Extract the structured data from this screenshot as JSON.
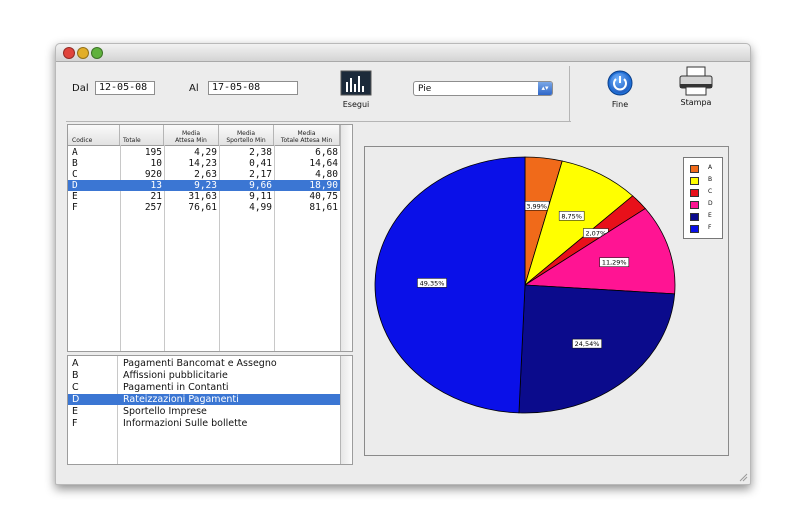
{
  "toolbar": {
    "dal_label": "Dal",
    "dal_value": "12-05-08",
    "al_label": "Al",
    "al_value": "17-05-08",
    "esegui_label": "Esegui",
    "chart_type": "Pie",
    "fine_label": "Fine",
    "stampa_label": "Stampa"
  },
  "table": {
    "headers": [
      "Codice",
      "Totale",
      "Media\nAttesa Min",
      "Media\nSportello Min",
      "Media\nTotale Attesa Min"
    ],
    "rows": [
      {
        "codice": "A",
        "totale": "195",
        "attesa": "4,29",
        "sportello": "2,38",
        "totale_attesa": "6,68"
      },
      {
        "codice": "B",
        "totale": "10",
        "attesa": "14,23",
        "sportello": "0,41",
        "totale_attesa": "14,64"
      },
      {
        "codice": "C",
        "totale": "920",
        "attesa": "2,63",
        "sportello": "2,17",
        "totale_attesa": "4,80"
      },
      {
        "codice": "D",
        "totale": "13",
        "attesa": "9,23",
        "sportello": "9,66",
        "totale_attesa": "18,90"
      },
      {
        "codice": "E",
        "totale": "21",
        "attesa": "31,63",
        "sportello": "9,11",
        "totale_attesa": "40,75"
      },
      {
        "codice": "F",
        "totale": "257",
        "attesa": "76,61",
        "sportello": "4,99",
        "totale_attesa": "81,61"
      }
    ],
    "selected_index": 3
  },
  "list": {
    "items": [
      {
        "code": "A",
        "desc": "Pagamenti Bancomat e Assegno"
      },
      {
        "code": "B",
        "desc": "Affissioni pubblicitarie"
      },
      {
        "code": "C",
        "desc": "Pagamenti  in Contanti"
      },
      {
        "code": "D",
        "desc": "Rateizzazioni Pagamenti"
      },
      {
        "code": "E",
        "desc": "Sportello Imprese"
      },
      {
        "code": "F",
        "desc": "Informazioni Sulle bollette"
      }
    ],
    "selected_index": 3
  },
  "chart_data": {
    "type": "pie",
    "categories": [
      "A",
      "B",
      "C",
      "D",
      "E",
      "F"
    ],
    "values": [
      3.99,
      8.75,
      2.07,
      11.29,
      24.54,
      49.35
    ],
    "labels": [
      "3,99%",
      "8,75%",
      "2,07%",
      "11,29%",
      "24,54%",
      "49,35%"
    ],
    "colors": [
      "#f06a1a",
      "#ffff00",
      "#e8101a",
      "#ff1493",
      "#0b0b8c",
      "#0a10e8"
    ],
    "legend_position": "top-right"
  }
}
